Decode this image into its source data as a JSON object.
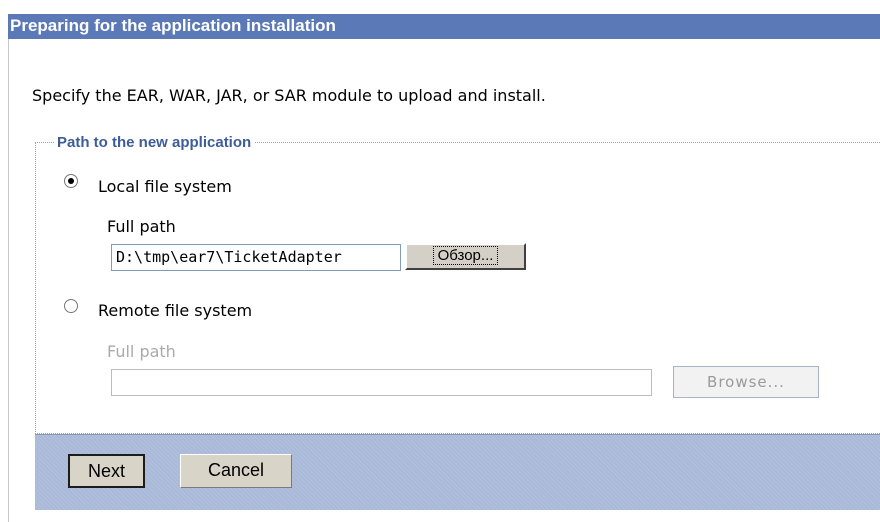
{
  "header": {
    "title": "Preparing for the application installation"
  },
  "instructions": "Specify the EAR, WAR, JAR, or SAR module to upload and install.",
  "path_group": {
    "legend": "Path to the new application",
    "local": {
      "label": "Local file system",
      "selected": true,
      "full_path_label": "Full path",
      "value": "D:\\tmp\\ear7\\TicketAdapter",
      "browse_label": "Обзор..."
    },
    "remote": {
      "label": "Remote file system",
      "selected": false,
      "full_path_label": "Full path",
      "value": "",
      "browse_label": "Browse..."
    }
  },
  "footer": {
    "next_label": "Next",
    "cancel_label": "Cancel"
  }
}
